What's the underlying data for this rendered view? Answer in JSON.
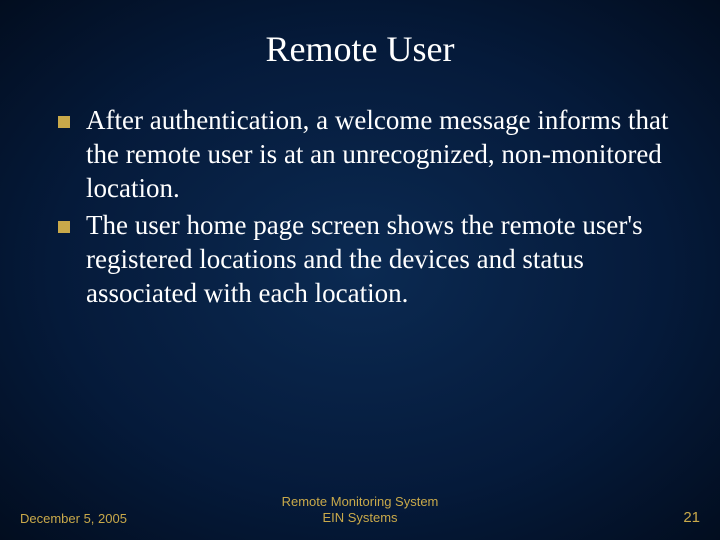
{
  "slide": {
    "title": "Remote User",
    "bullets": [
      "After authentication, a welcome message informs that the remote user is at an unrecognized, non-monitored location.",
      "The user home page screen shows the remote user's registered locations and the devices and status associated with each location."
    ]
  },
  "footer": {
    "date": "December 5, 2005",
    "center_line1": "Remote Monitoring System",
    "center_line2": "EIN Systems",
    "page_number": "21"
  },
  "colors": {
    "accent": "#c9a94a",
    "bg_center": "#0b2a52",
    "bg_edge": "#020d1f",
    "text": "#ffffff"
  }
}
